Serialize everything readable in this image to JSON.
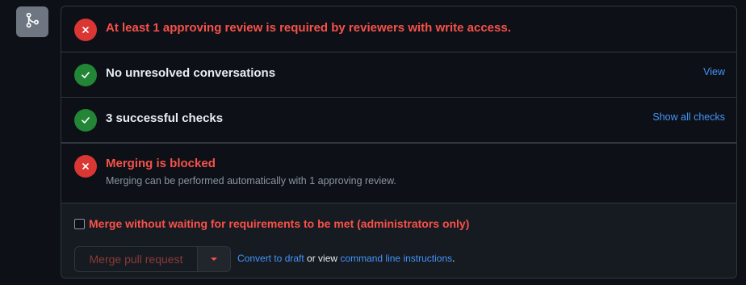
{
  "colors": {
    "fail": "#da3633",
    "success": "#238636",
    "link": "#4493f8",
    "danger_text": "#f85149"
  },
  "merge_icon": "git-merge-icon",
  "rows": [
    {
      "status": "fail",
      "icon": "x-circle-icon",
      "title": "At least 1 approving review is required by reviewers with write access."
    },
    {
      "status": "success",
      "icon": "check-circle-icon",
      "title": "No unresolved conversations",
      "link": "View"
    },
    {
      "status": "success",
      "icon": "check-circle-icon",
      "title": "3 successful checks",
      "link": "Show all checks"
    },
    {
      "status": "fail",
      "icon": "x-circle-icon",
      "title": "Merging is blocked",
      "subtitle": "Merging can be performed automatically with 1 approving review."
    }
  ],
  "footer": {
    "bypass_label": "Merge without waiting for requirements to be met (administrators only)",
    "bypass_checked": false,
    "merge_button_label": "Merge pull request",
    "convert_link": "Convert to draft",
    "or_view_text": " or view ",
    "cli_link": "command line instructions",
    "period": "."
  }
}
